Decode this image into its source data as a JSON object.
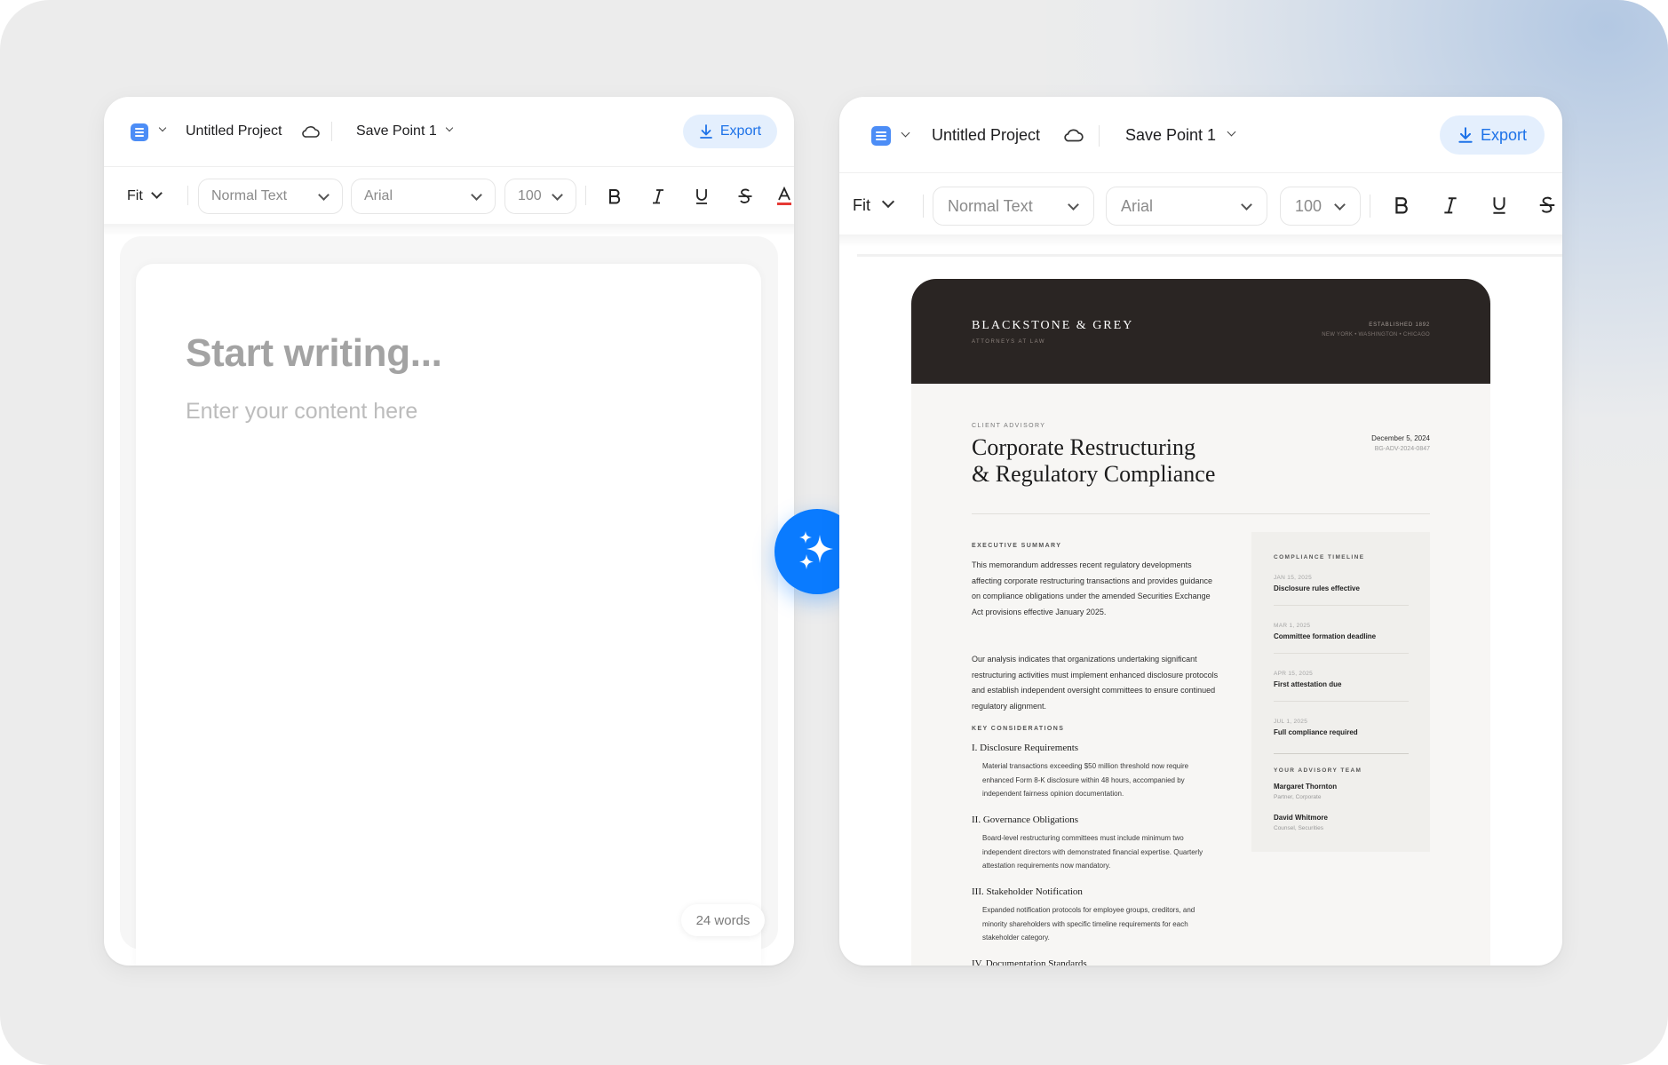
{
  "project": {
    "title": "Untitled Project",
    "save_point": "Save Point 1",
    "export_label": "Export"
  },
  "toolbar": {
    "zoom": "Fit",
    "style": "Normal Text",
    "font": "Arial",
    "size": "100",
    "icons": [
      "bold-icon",
      "italic-icon",
      "underline-icon",
      "strikethrough-icon",
      "text-color-icon"
    ]
  },
  "editor": {
    "placeholder_title": "Start writing...",
    "placeholder_body": "Enter your content here",
    "word_count": "24 words"
  },
  "colors": {
    "accent": "#0a7bff",
    "export_bg": "#e4effd",
    "doc_header": "#2a2523",
    "text_color_underline": "#e53935"
  },
  "document": {
    "firm": "BLACKSTONE & GREY",
    "firm_sub": "ATTORNEYS AT LAW",
    "established": "ESTABLISHED 1892",
    "cities": "NEW YORK • WASHINGTON • CHICAGO",
    "label": "CLIENT ADVISORY",
    "title_line1": "Corporate Restructuring",
    "title_line2": "& Regulatory Compliance",
    "date": "December 5, 2024",
    "ref": "BG-ADV-2024-0847",
    "exec_label": "EXECUTIVE SUMMARY",
    "exec_p1": "This memorandum addresses recent regulatory developments affecting corporate restructuring transactions and provides guidance on compliance obligations under the amended Securities Exchange Act provisions effective January 2025.",
    "exec_p2": "Our analysis indicates that organizations undertaking significant restructuring activities must implement enhanced disclosure protocols and establish independent oversight committees to ensure continued regulatory alignment.",
    "key_label": "KEY CONSIDERATIONS",
    "sections": [
      {
        "heading": "I. Disclosure Requirements",
        "body": "Material transactions exceeding $50 million threshold now require enhanced Form 8-K disclosure within 48 hours, accompanied by independent fairness opinion documentation."
      },
      {
        "heading": "II. Governance Obligations",
        "body": "Board-level restructuring committees must include minimum two independent directors with demonstrated financial expertise. Quarterly attestation requirements now mandatory."
      },
      {
        "heading": "III. Stakeholder Notification",
        "body": "Expanded notification protocols for employee groups, creditors, and minority shareholders with specific timeline requirements for each stakeholder category."
      },
      {
        "heading": "IV. Documentation Standards",
        "body": ""
      }
    ],
    "timeline_label": "COMPLIANCE TIMELINE",
    "timeline": [
      {
        "date": "JAN 15, 2025",
        "text": "Disclosure rules effective"
      },
      {
        "date": "MAR 1, 2025",
        "text": "Committee formation deadline"
      },
      {
        "date": "APR 15, 2025",
        "text": "First attestation due"
      },
      {
        "date": "JUL 1, 2025",
        "text": "Full compliance required"
      }
    ],
    "team_label": "YOUR ADVISORY TEAM",
    "team": [
      {
        "name": "Margaret Thornton",
        "role": "Partner, Corporate"
      },
      {
        "name": "David Whitmore",
        "role": "Counsel, Securities"
      }
    ]
  }
}
